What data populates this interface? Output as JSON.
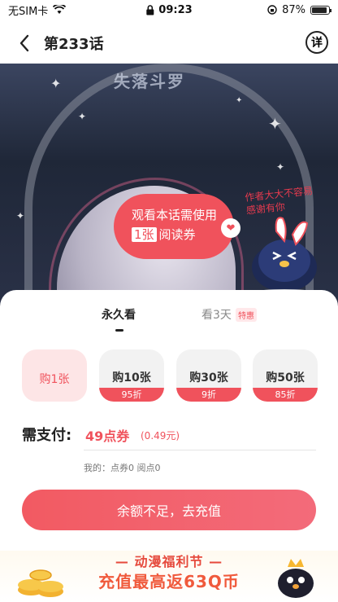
{
  "status_bar": {
    "carrier": "无SIM卡",
    "time": "09:23",
    "battery": "87%"
  },
  "nav": {
    "title": "第233话",
    "detail_label": "详"
  },
  "comic": {
    "banner_text": "失落斗罗",
    "bubble_line1": "观看本话需使用",
    "bubble_count": "1张",
    "bubble_line2": "阅读券",
    "cute_text": "作者大大不容易 感谢有你"
  },
  "purchase": {
    "tabs": [
      {
        "label": "永久看"
      },
      {
        "label": "看3天"
      }
    ],
    "tab_badge": "特惠",
    "options": [
      {
        "label": "购1张",
        "discount": ""
      },
      {
        "label": "购10张",
        "discount": "95折"
      },
      {
        "label": "购30张",
        "discount": "9折"
      },
      {
        "label": "购50张",
        "discount": "85折"
      }
    ],
    "pay_label": "需支付:",
    "pay_amount": "49点券",
    "pay_sub": "(0.49元)",
    "balance_text": "我的：点券0 阅点0",
    "cta_label": "余额不足，去充值"
  },
  "promo": {
    "line1": "— 动漫福利节 —",
    "line2": "充值最高返63Q币"
  },
  "colors": {
    "accent": "#f0525c",
    "selected_bg": "#fde5e6"
  }
}
